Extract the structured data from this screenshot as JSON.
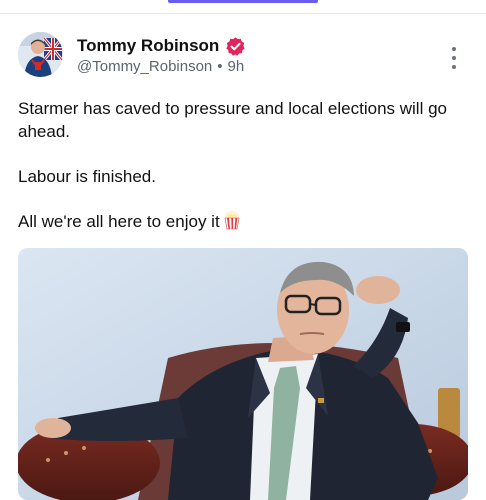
{
  "post": {
    "author": {
      "display_name": "Tommy Robinson",
      "handle": "@Tommy_Robinson",
      "verified": true,
      "avatar_icon": "avatar-image"
    },
    "separator": "•",
    "time_ago": "9h",
    "more_icon": "more-vertical-icon",
    "body": {
      "paragraph_1": "Starmer has caved to pressure and local elections will go ahead.",
      "paragraph_2": "Labour is finished.",
      "paragraph_3": "All we're all here to enjoy it",
      "emoji": "popcorn-icon"
    },
    "media": {
      "kind": "photo",
      "icon": "post-photo"
    }
  },
  "colors": {
    "verified_badge": "#e0245e",
    "handle_text": "#5b6470",
    "tab_indicator": "#6a5cf0"
  }
}
